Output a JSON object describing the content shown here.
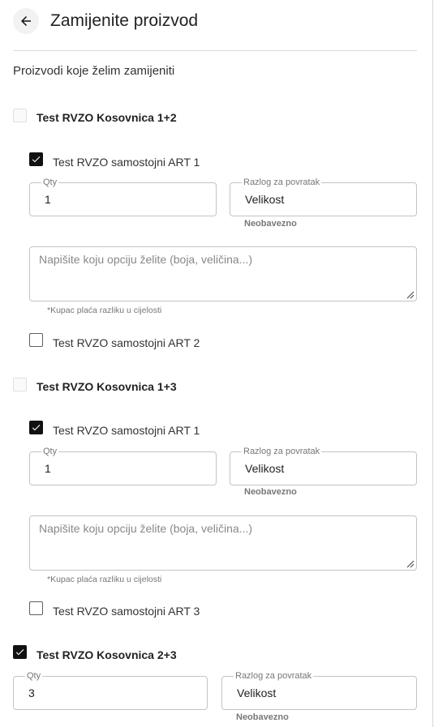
{
  "header": {
    "title": "Zamijenite proizvod",
    "back_icon": "arrow-left-icon"
  },
  "section_label": "Proizvodi koje želim zamijeniti",
  "bundles": [
    {
      "label": "Test RVZO Kosovnica 1+2",
      "checked": false,
      "items": [
        {
          "label": "Test RVZO samostojni ART 1",
          "checked": true,
          "qty_label": "Qty",
          "qty_value": "1",
          "reason_label": "Razlog za povratak",
          "reason_value": "Velikost",
          "reason_helper": "Neobavezno",
          "textarea_placeholder": "Napišite koju opciju želite (boja, veličina...)",
          "textarea_helper": "*Kupac plaća razliku u cijelosti"
        },
        {
          "label": "Test RVZO samostojni ART 2",
          "checked": false
        }
      ]
    },
    {
      "label": "Test RVZO Kosovnica 1+3",
      "checked": false,
      "items": [
        {
          "label": "Test RVZO samostojni ART 1",
          "checked": true,
          "qty_label": "Qty",
          "qty_value": "1",
          "reason_label": "Razlog za povratak",
          "reason_value": "Velikost",
          "reason_helper": "Neobavezno",
          "textarea_placeholder": "Napišite koju opciju želite (boja, veličina...)",
          "textarea_helper": "*Kupac plaća razliku u cijelosti"
        },
        {
          "label": "Test RVZO samostojni ART 3",
          "checked": false
        }
      ]
    },
    {
      "label": "Test RVZO Kosovnica 2+3",
      "checked": true,
      "qty_label": "Qty",
      "qty_value": "3",
      "reason_label": "Razlog za povratak",
      "reason_value": "Velikost",
      "reason_helper": "Neobavezno"
    }
  ]
}
